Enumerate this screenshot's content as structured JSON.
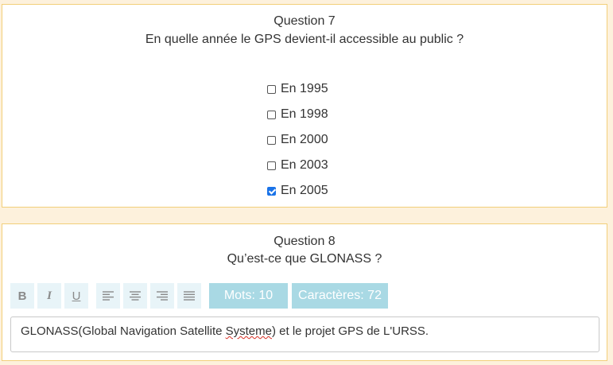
{
  "question7": {
    "number_label": "Question 7",
    "text": "En quelle année le GPS devient-il accessible au public ?",
    "options": [
      {
        "label": "En 1995",
        "checked": false
      },
      {
        "label": "En 1998",
        "checked": false
      },
      {
        "label": "En 2000",
        "checked": false
      },
      {
        "label": "En 2003",
        "checked": false
      },
      {
        "label": "En 2005",
        "checked": true
      }
    ]
  },
  "question8": {
    "number_label": "Question 8",
    "text": "Qu’est-ce que GLONASS ?",
    "toolbar": {
      "bold": "B",
      "italic": "I",
      "underline": "U",
      "icons": [
        "align-left-icon",
        "align-center-icon",
        "align-right-icon",
        "align-justify-icon"
      ]
    },
    "words_count": "Mots: 10",
    "chars_count": "Caractères: 72",
    "answer": {
      "before": "GLONASS(Global Navigation Satellite ",
      "misspelled": "Systeme",
      "after": ") et le projet GPS de L'URSS."
    }
  },
  "colors": {
    "background": "#fdf1dc",
    "card_border": "#f2cf7a",
    "toolbar_button": "#e8f4f8",
    "counter_badge": "#a9d9e4",
    "checkbox_checked": "#1a73e8"
  }
}
